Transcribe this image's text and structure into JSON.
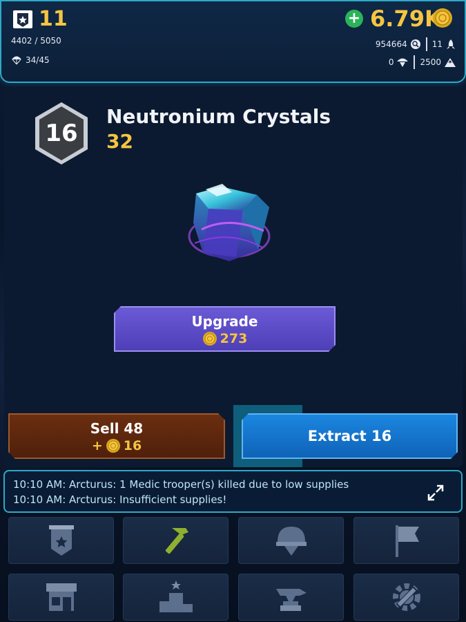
{
  "header": {
    "player_level": "11",
    "xp_progress": "4402 / 5050",
    "troops": "34/45",
    "currency_amount": "6.79K",
    "add_currency_label": "+",
    "stat_resource_1": "954664",
    "stat_ships": "11",
    "stat_troops": "0",
    "stat_capacity": "2500"
  },
  "item": {
    "level": "16",
    "name": "Neutronium Crystals",
    "count": "32"
  },
  "actions": {
    "upgrade_label": "Upgrade",
    "upgrade_cost": "273",
    "sell_label": "Sell 48",
    "sell_gain": "+",
    "sell_gain_amount": "16",
    "extract_label": "Extract 16"
  },
  "log": {
    "lines": [
      "10:10 AM: Arcturus: 1 Medic trooper(s) killed due to low supplies",
      "10:10 AM: Arcturus: Insufficient supplies!"
    ]
  },
  "nav": {
    "items": [
      "base-icon",
      "hammer-icon",
      "helmet-icon",
      "flag-icon",
      "shop-icon",
      "podium-icon",
      "anvil-icon",
      "settings-icon"
    ]
  },
  "colors": {
    "accent_gold": "#f5c542",
    "border_cyan": "#2fa8c8",
    "upgrade_purple": "#5a4bc7",
    "sell_brown": "#5e2a0e",
    "extract_blue": "#1676cc",
    "active_hammer": "#8fb02e"
  }
}
